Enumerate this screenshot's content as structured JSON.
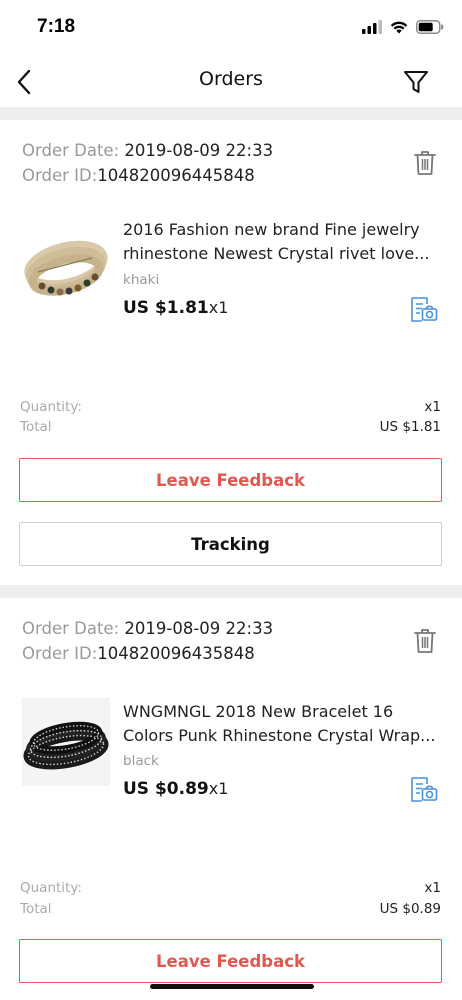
{
  "status_bar": {
    "time": "7:18"
  },
  "nav": {
    "title": "Orders"
  },
  "orders": [
    {
      "date_label": "Order Date:",
      "date_value": "2019-08-09 22:33",
      "id_label": "Order ID:",
      "id_value": "104820096445848",
      "product_title_line1": "2016 Fashion new brand Fine jewelry",
      "product_title_line2": "rhinestone Newest Crystal rivet love...",
      "variant": "khaki",
      "price": "US $1.81",
      "qty_suffix": "x1",
      "quantity_label": "Quantity:",
      "quantity_value": "x1",
      "total_label": "Total",
      "total_value": "US $1.81",
      "feedback_label": "Leave Feedback",
      "tracking_label": "Tracking"
    },
    {
      "date_label": "Order Date:",
      "date_value": "2019-08-09 22:33",
      "id_label": "Order ID:",
      "id_value": "104820096435848",
      "product_title_line1": "WNGMNGL 2018 New Bracelet 16",
      "product_title_line2": "Colors Punk Rhinestone Crystal Wrap...",
      "variant": "black",
      "price": "US $0.89",
      "qty_suffix": "x1",
      "quantity_label": "Quantity:",
      "quantity_value": "x1",
      "total_label": "Total",
      "total_value": "US $0.89",
      "feedback_label": "Leave Feedback"
    }
  ],
  "colors": {
    "accent": "#e0584f",
    "icon_blue": "#4a90d9",
    "separator": "#eeeeee"
  },
  "icons": [
    "back-arrow-icon",
    "filter-icon",
    "trash-icon",
    "snapshot-icon",
    "signal-icon",
    "wifi-icon",
    "battery-icon"
  ]
}
